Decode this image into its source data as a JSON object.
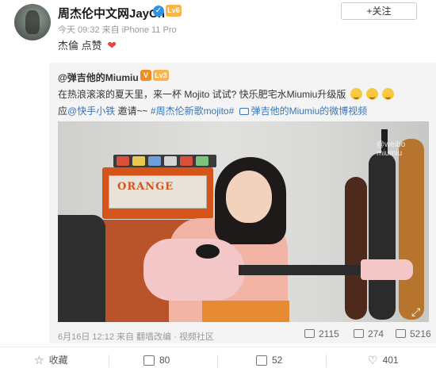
{
  "post": {
    "author": "周杰伦中文网JayCn",
    "rank_badge": "Lv6",
    "meta": "今天 09:32 来自 iPhone 11 Pro",
    "follow_label": "+关注",
    "text": "杰倫 点赞",
    "heart": "❤"
  },
  "repost": {
    "author": "@弹吉他的Miumiu",
    "v_badge": "V",
    "rank_badge": "Lv3",
    "line1": "在热浪滚滚的夏天里，来一杯 Mojito 试试? 快乐肥宅水Miumiu升级版",
    "line2_prefix": "应",
    "mention": "@快手小铁",
    "invite": " 邀请~~ ",
    "topic": "#周杰伦新歌mojito#",
    "video_link": "弹吉他的Miumiu的微博视频",
    "amp_brand": "ORANGE",
    "video_watermark": "@weibo miumiu",
    "footer": "6月16日 12:12 来自 翻墙改编 · 视频社区",
    "stats": {
      "reposts": "2115",
      "comments": "274",
      "likes": "5216"
    }
  },
  "toolbar": {
    "favorite": "收藏",
    "repost": "80",
    "comment": "52",
    "like": "401"
  },
  "icons": [
    "verified-icon",
    "heart-icon",
    "emoji-icon",
    "video-link-icon",
    "expand-icon",
    "repost-icon",
    "comment-icon",
    "like-icon",
    "star-icon"
  ],
  "colors": {
    "link": "#3b76b8",
    "verified": "#2d95e8",
    "badge_orange": "#f28c24",
    "heart": "#e2473a"
  }
}
